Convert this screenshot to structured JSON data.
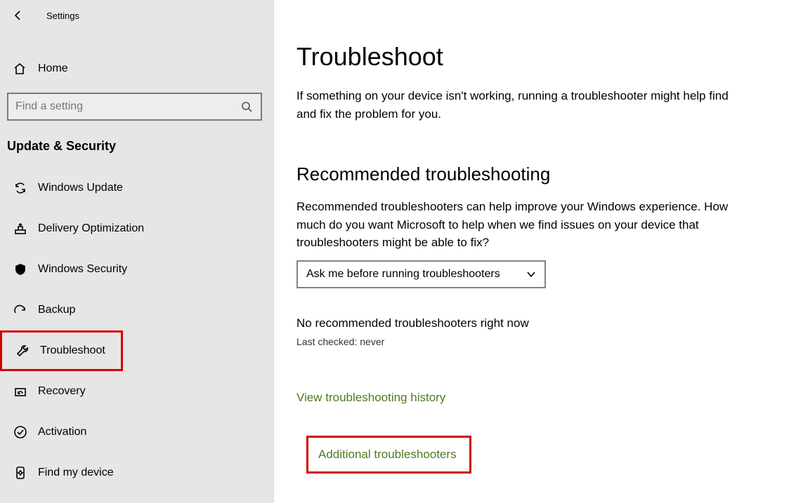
{
  "app": {
    "title": "Settings"
  },
  "sidebar": {
    "home": "Home",
    "search_placeholder": "Find a setting",
    "category": "Update & Security",
    "items": [
      {
        "id": "windows-update",
        "label": "Windows Update"
      },
      {
        "id": "delivery-optimization",
        "label": "Delivery Optimization"
      },
      {
        "id": "windows-security",
        "label": "Windows Security"
      },
      {
        "id": "backup",
        "label": "Backup"
      },
      {
        "id": "troubleshoot",
        "label": "Troubleshoot",
        "selected": true
      },
      {
        "id": "recovery",
        "label": "Recovery"
      },
      {
        "id": "activation",
        "label": "Activation"
      },
      {
        "id": "find-my-device",
        "label": "Find my device"
      }
    ]
  },
  "main": {
    "title": "Troubleshoot",
    "intro": "If something on your device isn't working, running a troubleshooter might help find and fix the problem for you.",
    "section_title": "Recommended troubleshooting",
    "section_desc": "Recommended troubleshooters can help improve your Windows experience. How much do you want Microsoft to help when we find issues on your device that troubleshooters might be able to fix?",
    "dropdown_value": "Ask me before running troubleshooters",
    "status": "No recommended troubleshooters right now",
    "status_sub": "Last checked: never",
    "link_history": "View troubleshooting history",
    "link_additional": "Additional troubleshooters"
  }
}
